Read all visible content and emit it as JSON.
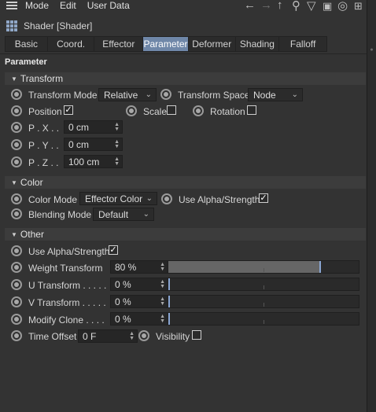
{
  "menubar": {
    "items": [
      "Mode",
      "Edit",
      "User Data"
    ]
  },
  "toolbar": {
    "icons": [
      "back-arrow-icon",
      "forward-arrow-icon",
      "up-arrow-icon",
      "search-icon",
      "filter-icon",
      "lock-icon",
      "target-icon",
      "new-panel-icon"
    ]
  },
  "object": {
    "name": "Shader [Shader]"
  },
  "tabs": [
    {
      "label": "Basic",
      "active": false
    },
    {
      "label": "Coord.",
      "active": false
    },
    {
      "label": "Effector",
      "active": false
    },
    {
      "label": "Parameter",
      "active": true
    },
    {
      "label": "Deformer",
      "active": false
    },
    {
      "label": "Shading",
      "active": false
    },
    {
      "label": "Falloff",
      "active": false
    }
  ],
  "parameter_title": "Parameter",
  "transform": {
    "section": "Transform",
    "mode_label": "Transform Mode",
    "mode_value": "Relative",
    "space_label": "Transform Space",
    "space_value": "Node",
    "position_label": "Position",
    "position_checked": true,
    "scale_label": "Scale",
    "scale_checked": false,
    "rotation_label": "Rotation",
    "rotation_checked": false,
    "px_label": "P . X . .",
    "px_value": "0 cm",
    "py_label": "P . Y . .",
    "py_value": "0 cm",
    "pz_label": "P . Z . .",
    "pz_value": "100 cm"
  },
  "color": {
    "section": "Color",
    "mode_label": "Color Mode",
    "mode_value": "Effector Color",
    "alpha_label": "Use Alpha/Strength",
    "alpha_checked": true,
    "blend_label": "Blending Mode",
    "blend_value": "Default"
  },
  "other": {
    "section": "Other",
    "alpha_label": "Use Alpha/Strength",
    "alpha_checked": true,
    "weight_label": "Weight Transform",
    "weight_value": "80 %",
    "weight_fraction": 0.8,
    "u_label": "U Transform . . . . .",
    "u_value": "0 %",
    "u_fraction": 0,
    "v_label": "V Transform . . . . .",
    "v_value": "0 %",
    "v_fraction": 0,
    "clone_label": "Modify Clone . . . .",
    "clone_value": "0 %",
    "clone_fraction": 0,
    "time_label": "Time Offset",
    "time_value": "0 F",
    "visibility_label": "Visibility",
    "visibility_checked": false
  },
  "colors": {
    "background": "#333333",
    "active_tab": "#6f87a8",
    "slider_handle": "#8aa6d2",
    "slider_fill": "#666666"
  }
}
